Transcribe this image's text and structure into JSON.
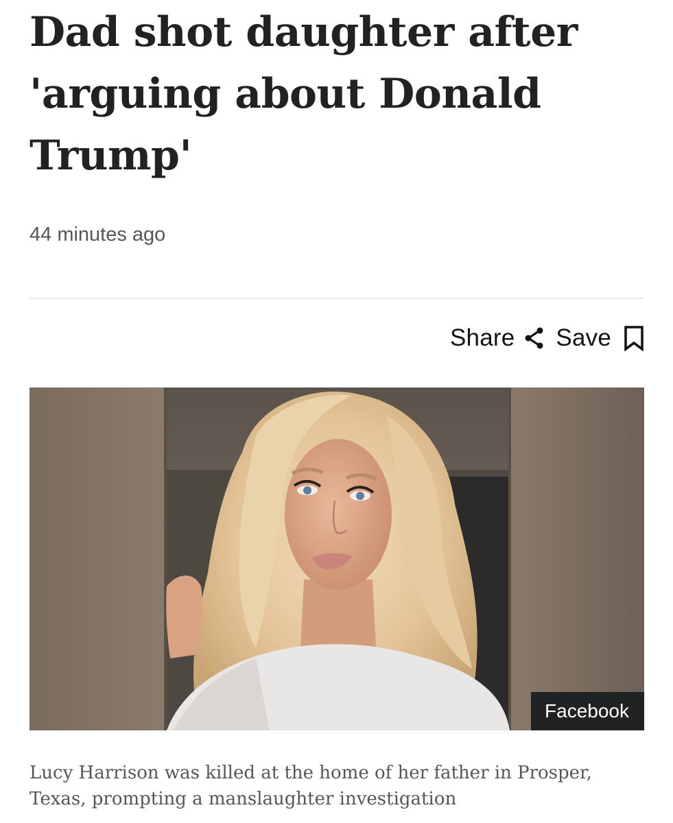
{
  "article": {
    "headline": "Dad shot daughter after 'arguing about Donald Trump'",
    "timestamp": "44 minutes ago"
  },
  "actions": {
    "share_label": "Share",
    "share_icon": "share-icon",
    "save_label": "Save",
    "save_icon": "bookmark-icon"
  },
  "image": {
    "credit": "Facebook",
    "caption": "Lucy Harrison was killed at the home of her father in Prosper, Texas, prompting a manslaughter investigation"
  }
}
